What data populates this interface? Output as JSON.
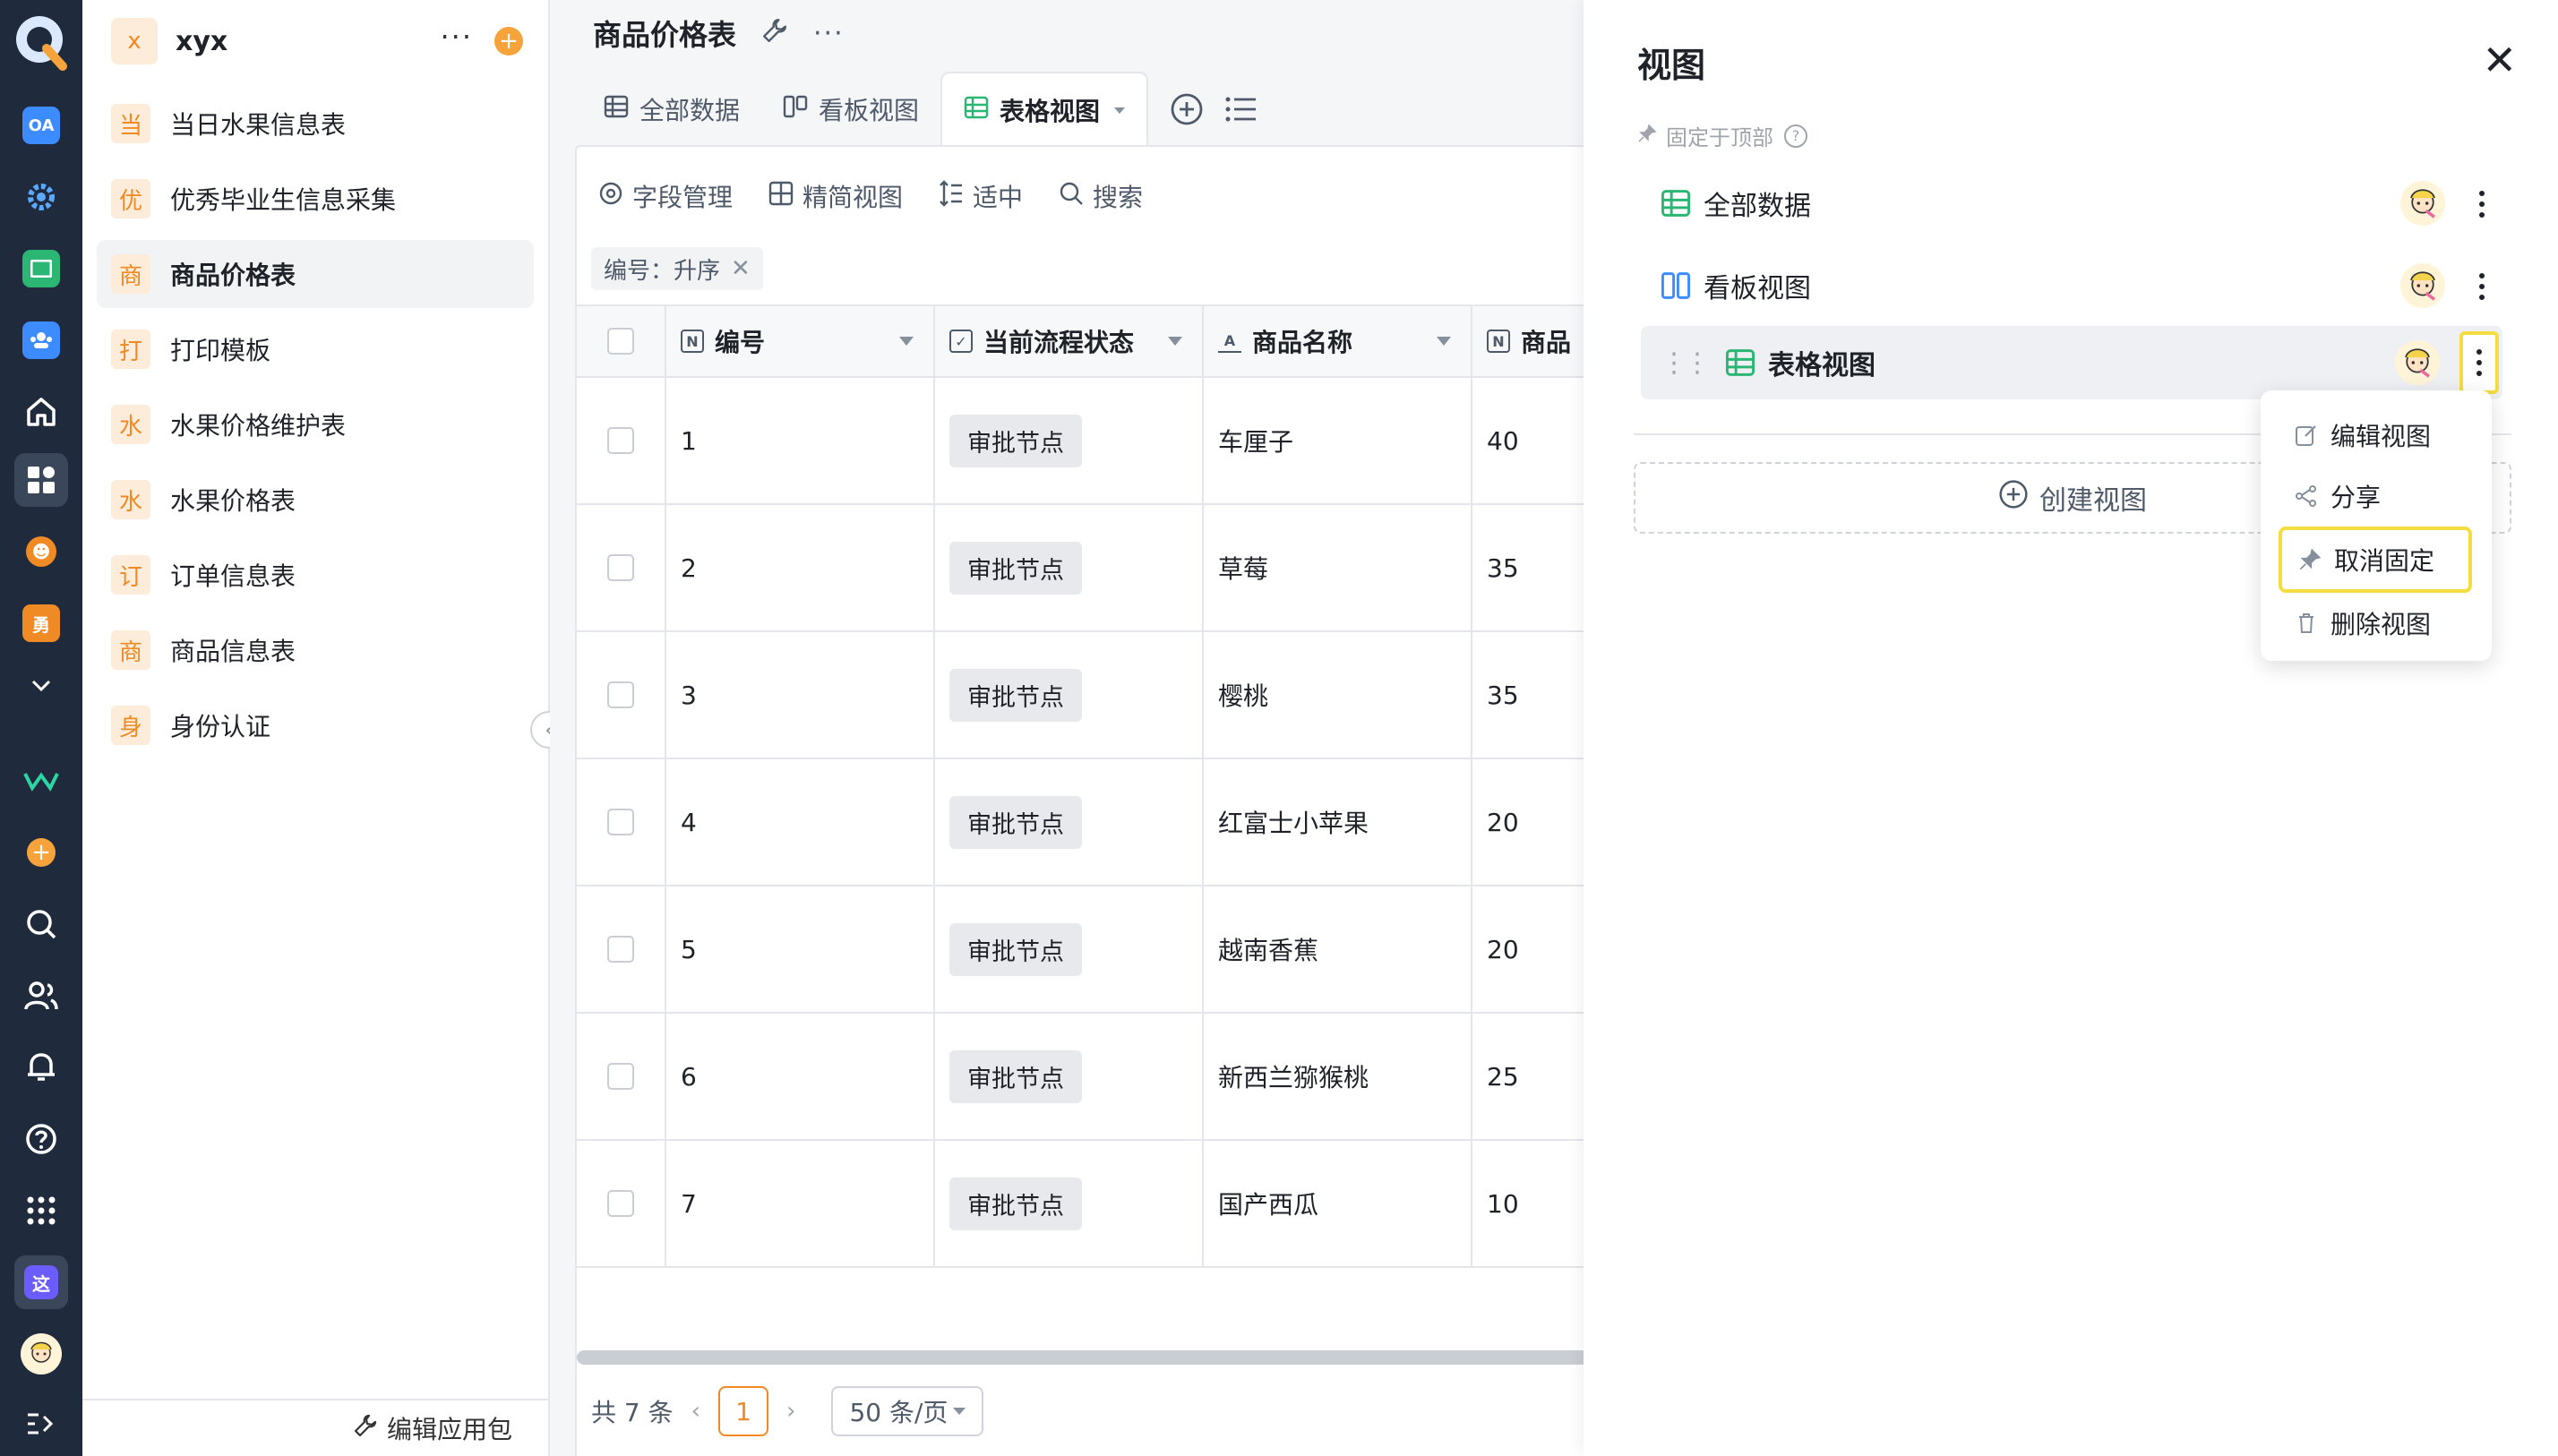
{
  "rail": {
    "logo": "Q",
    "apps": [
      {
        "icon": "oa-app-icon",
        "label": "OA",
        "color": "#3d8cff"
      },
      {
        "icon": "gear-app-icon",
        "label": "",
        "color": "#3d8cff"
      },
      {
        "icon": "sheet-app-icon",
        "label": "",
        "color": "#2bb673"
      },
      {
        "icon": "team-app-icon",
        "label": "",
        "color": "#3d8cff"
      },
      {
        "icon": "home-icon",
        "label": ""
      },
      {
        "icon": "apps-grid-icon",
        "label": ""
      },
      {
        "icon": "smile-app-icon",
        "label": "",
        "color": "#f08a24"
      },
      {
        "icon": "yong-app-icon",
        "label": "勇",
        "color": "#f08a24"
      },
      {
        "icon": "chevron-down-icon",
        "label": ""
      }
    ],
    "bottom": [
      "w-logo-icon",
      "add-circle-icon",
      "search-icon",
      "contacts-icon",
      "bell-icon",
      "help-icon",
      "grid-icon",
      "zhe-app-icon",
      "user-avatar-icon",
      "expand-icon"
    ],
    "zhe_label": "这"
  },
  "sidebar": {
    "workspace_badge": "x",
    "workspace_name": "xyx",
    "items": [
      {
        "badge": "当",
        "label": "当日水果信息表"
      },
      {
        "badge": "优",
        "label": "优秀毕业生信息采集"
      },
      {
        "badge": "商",
        "label": "商品价格表",
        "active": true
      },
      {
        "badge": "打",
        "label": "打印模板"
      },
      {
        "badge": "水",
        "label": "水果价格维护表"
      },
      {
        "badge": "水",
        "label": "水果价格表"
      },
      {
        "badge": "订",
        "label": "订单信息表"
      },
      {
        "badge": "商",
        "label": "商品信息表"
      },
      {
        "badge": "身",
        "label": "身份认证"
      }
    ],
    "footer_label": "编辑应用包"
  },
  "main": {
    "title": "商品价格表",
    "tabs": [
      {
        "label": "全部数据",
        "icon": "table-icon"
      },
      {
        "label": "看板视图",
        "icon": "kanban-icon"
      },
      {
        "label": "表格视图",
        "icon": "table-icon",
        "active": true
      }
    ],
    "toolbar": {
      "fields": "字段管理",
      "compact": "精简视图",
      "density": "适中",
      "search": "搜索"
    },
    "sort_chip": "编号：升序",
    "columns": [
      "编号",
      "当前流程状态",
      "商品名称",
      "商品"
    ],
    "rows": [
      {
        "id": "1",
        "status": "审批节点",
        "name": "车厘子",
        "price": "40"
      },
      {
        "id": "2",
        "status": "审批节点",
        "name": "草莓",
        "price": "35"
      },
      {
        "id": "3",
        "status": "审批节点",
        "name": "樱桃",
        "price": "35"
      },
      {
        "id": "4",
        "status": "审批节点",
        "name": "红富士小苹果",
        "price": "20"
      },
      {
        "id": "5",
        "status": "审批节点",
        "name": "越南香蕉",
        "price": "20"
      },
      {
        "id": "6",
        "status": "审批节点",
        "name": "新西兰猕猴桃",
        "price": "25"
      },
      {
        "id": "7",
        "status": "审批节点",
        "name": "国产西瓜",
        "price": "10"
      }
    ],
    "pager": {
      "total": "共 7 条",
      "current_page": "1",
      "page_size": "50 条/页"
    }
  },
  "panel": {
    "title": "视图",
    "pin_hint": "固定于顶部",
    "views": [
      {
        "label": "全部数据",
        "icon": "table-icon"
      },
      {
        "label": "看板视图",
        "icon": "kanban-icon"
      },
      {
        "label": "表格视图",
        "icon": "table-icon",
        "active": true
      }
    ],
    "create_view": "创建视图",
    "menu": {
      "edit": "编辑视图",
      "share": "分享",
      "unpin": "取消固定",
      "delete": "删除视图"
    }
  },
  "colors": {
    "accent": "#f08a24",
    "highlight": "#f3dd3f",
    "table_icon": "#2bb673",
    "kanban_icon": "#3d8cff",
    "rail_bg": "#1f2a3c"
  }
}
